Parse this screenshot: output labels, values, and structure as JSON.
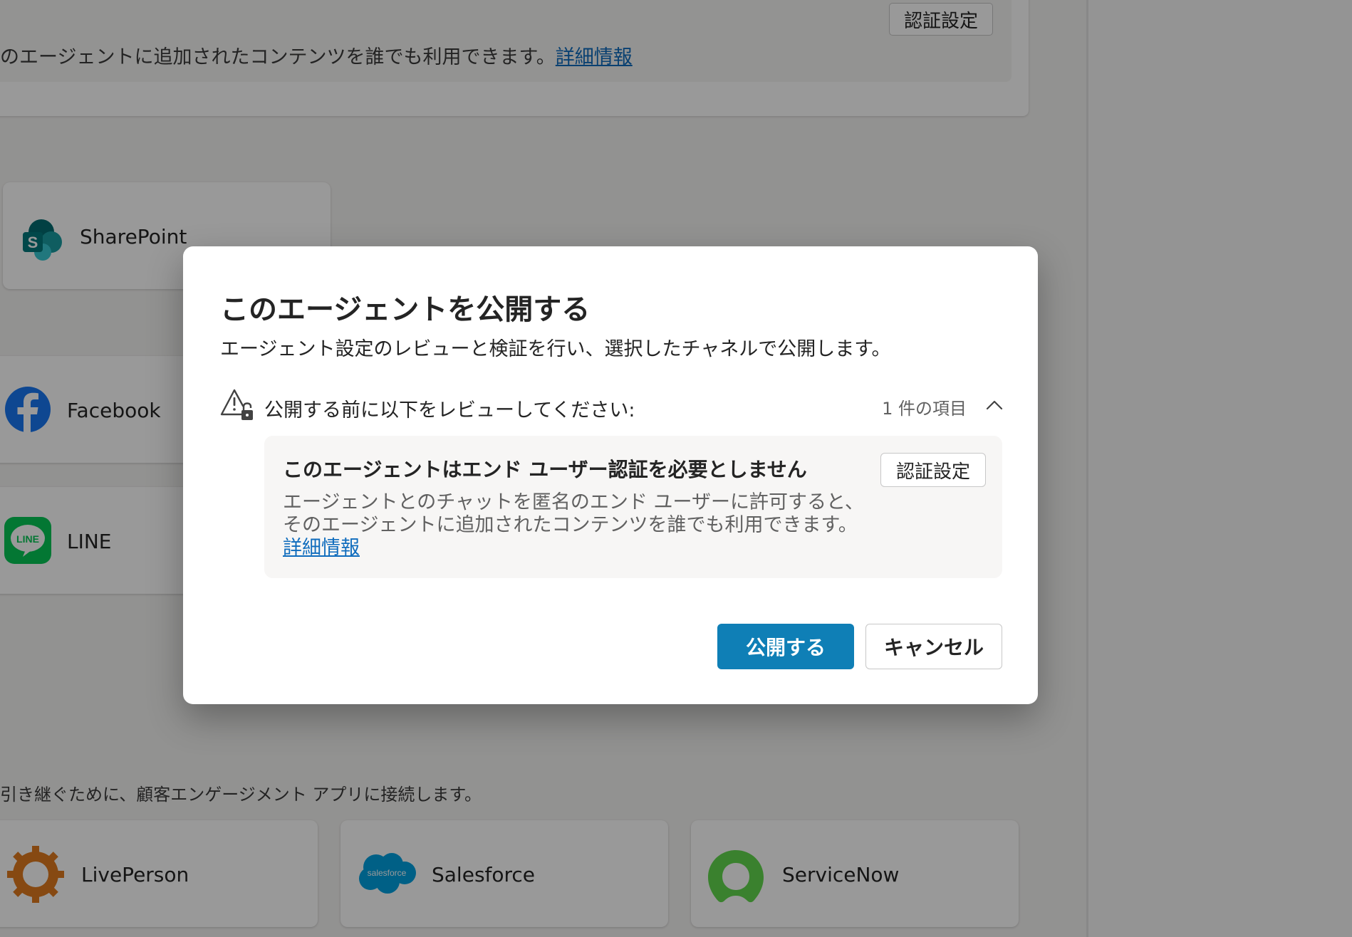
{
  "background": {
    "auth_notice": {
      "text": "のエージェントに追加されたコンテンツを誰でも利用できます。",
      "link": "詳細情報",
      "auth_button": "認証設定"
    },
    "channels": [
      {
        "name": "SharePoint",
        "icon": "sharepoint-icon"
      },
      {
        "name": "Facebook",
        "icon": "facebook-icon"
      },
      {
        "name": "LINE",
        "icon": "line-icon"
      }
    ],
    "engagement_section": {
      "description": "引き継ぐために、顧客エンゲージメント アプリに接続します。",
      "apps": [
        {
          "name": "LivePerson",
          "icon": "liveperson-icon"
        },
        {
          "name": "Salesforce",
          "icon": "salesforce-icon"
        },
        {
          "name": "ServiceNow",
          "icon": "servicenow-icon"
        }
      ]
    },
    "colors": {
      "sharepoint": "#038387",
      "facebook": "#1877f2",
      "line": "#06c755",
      "liveperson": "#e07b1f",
      "salesforce": "#00a1e0",
      "servicenow": "#62d84e"
    }
  },
  "dialog": {
    "title": "このエージェントを公開する",
    "description": "エージェント設定のレビューと検証を行い、選択したチャネルで公開します。",
    "review_label": "公開する前に以下をレビューしてください:",
    "review_count": "1 件の項目",
    "issue": {
      "title": "このエージェントはエンド ユーザー認証を必要としません",
      "text": "エージェントとのチャットを匿名のエンド ユーザーに許可すると、そのエージェントに追加されたコンテンツを誰でも利用できます。",
      "link": "詳細情報",
      "button": "認証設定"
    },
    "publish_button": "公開する",
    "cancel_button": "キャンセル",
    "colors": {
      "primary": "#0f7fb6"
    }
  }
}
